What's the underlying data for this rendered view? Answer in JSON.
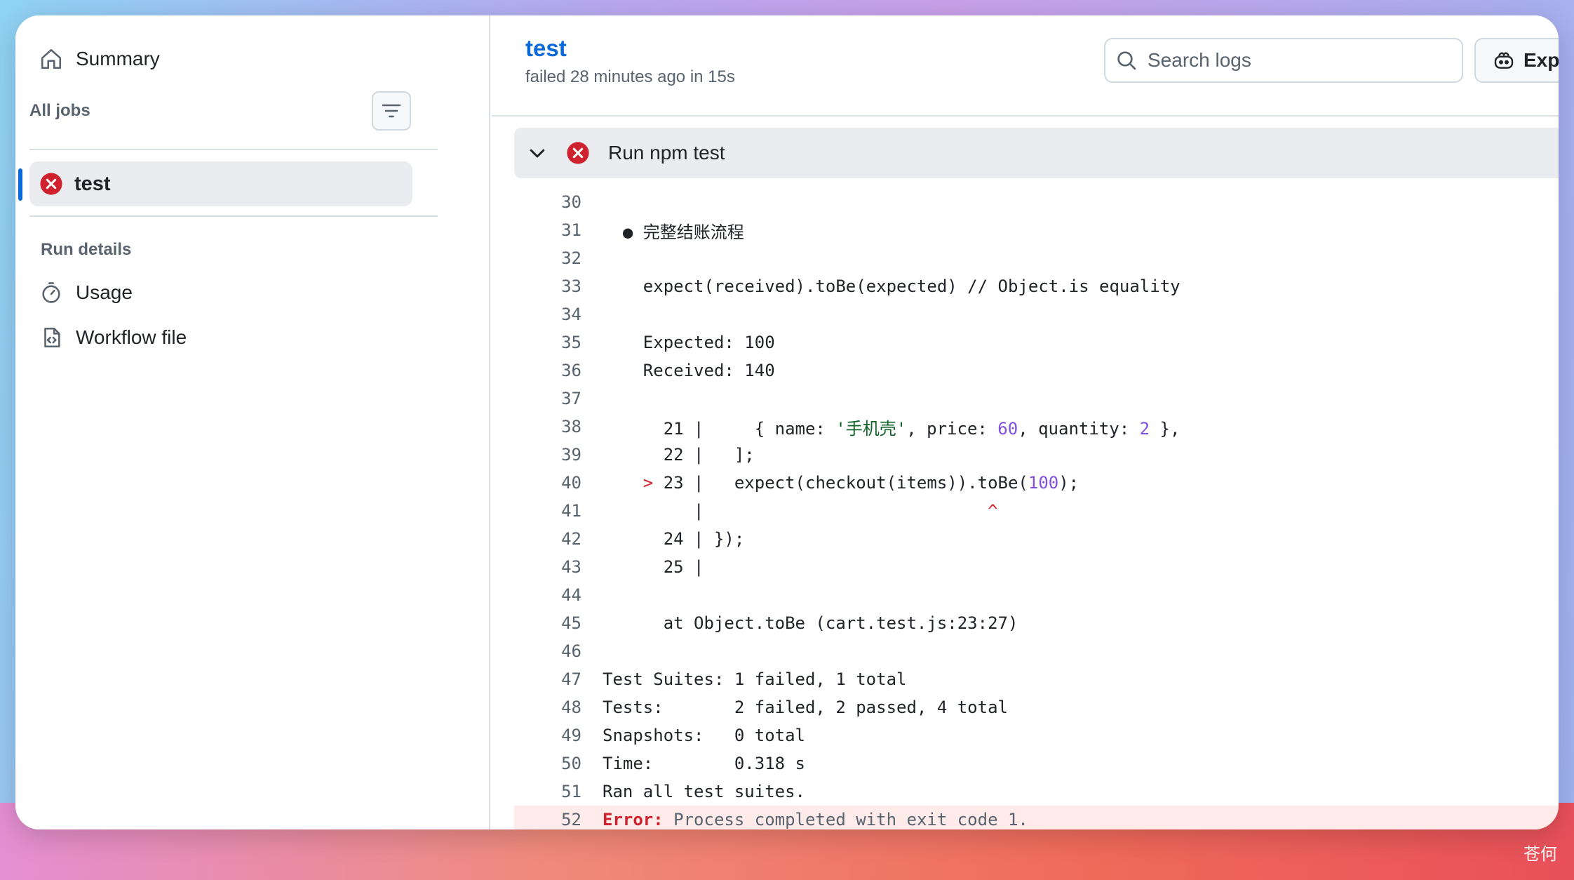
{
  "sidebar": {
    "summary_label": "Summary",
    "all_jobs_label": "All jobs",
    "jobs": [
      {
        "name": "test",
        "status": "failed"
      }
    ],
    "run_details_label": "Run details",
    "usage_label": "Usage",
    "workflow_label": "Workflow file"
  },
  "header": {
    "job_title": "test",
    "subtitle": "failed 28 minutes ago in 15s",
    "search_placeholder": "Search logs",
    "explain_label": "Exp"
  },
  "step": {
    "title": "Run npm test",
    "status": "failed"
  },
  "log_lines": [
    {
      "n": "30",
      "text": ""
    },
    {
      "n": "31",
      "text": "  ● 完整结账流程"
    },
    {
      "n": "32",
      "text": ""
    },
    {
      "n": "33",
      "text": "    expect(received).toBe(expected) // Object.is equality"
    },
    {
      "n": "34",
      "text": ""
    },
    {
      "n": "35",
      "text": "    Expected: 100"
    },
    {
      "n": "36",
      "text": "    Received: 140"
    },
    {
      "n": "37",
      "text": ""
    },
    {
      "n": "38",
      "text": "      21 |     { name: '手机壳', price: 60, quantity: 2 },"
    },
    {
      "n": "39",
      "text": "      22 |   ];"
    },
    {
      "n": "40",
      "text": "    > 23 |   expect(checkout(items)).toBe(100);"
    },
    {
      "n": "41",
      "text": "         |                            ^"
    },
    {
      "n": "42",
      "text": "      24 | });"
    },
    {
      "n": "43",
      "text": "      25 |"
    },
    {
      "n": "44",
      "text": ""
    },
    {
      "n": "45",
      "text": "      at Object.toBe (cart.test.js:23:27)"
    },
    {
      "n": "46",
      "text": ""
    },
    {
      "n": "47",
      "text": "Test Suites: 1 failed, 1 total"
    },
    {
      "n": "48",
      "text": "Tests:       2 failed, 2 passed, 4 total"
    },
    {
      "n": "49",
      "text": "Snapshots:   0 total"
    },
    {
      "n": "50",
      "text": "Time:        0.318 s"
    },
    {
      "n": "51",
      "text": "Ran all test suites."
    },
    {
      "n": "52",
      "text": "Process completed with exit code 1.",
      "error_label": "Error:"
    }
  ],
  "watermark": "苍何",
  "colors": {
    "accent": "#0969da",
    "error": "#cf222e",
    "error_bg": "#ffebe9",
    "number": "#8250df",
    "string": "#116329"
  }
}
